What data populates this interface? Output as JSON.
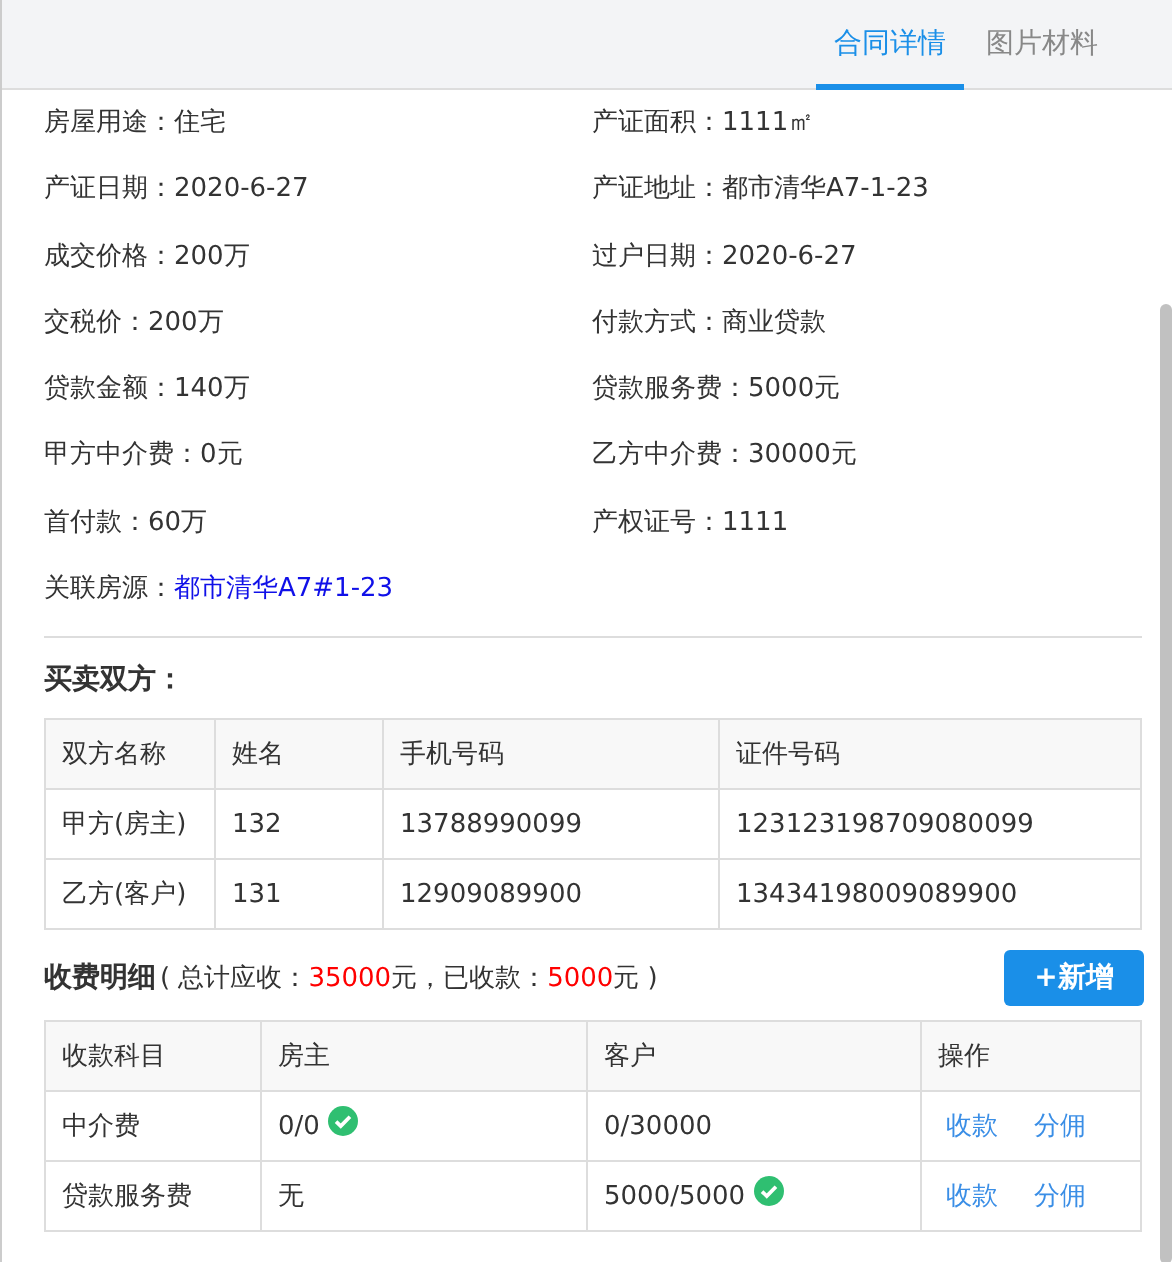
{
  "tabs": [
    {
      "label": "合同详情",
      "selected": true
    },
    {
      "label": "图片材料",
      "selected": false
    }
  ],
  "fields": [
    {
      "text": "房屋用途：住宅"
    },
    {
      "text": "产证面积：1111㎡"
    },
    {
      "text": "产证日期：2020-6-27"
    },
    {
      "text": "产证地址：都市清华A7-1-23"
    },
    {
      "text": "成交价格：200万"
    },
    {
      "text": "过户日期：2020-6-27"
    },
    {
      "text": "交税价：200万"
    },
    {
      "text": "付款方式：商业贷款"
    },
    {
      "text": "贷款金额：140万"
    },
    {
      "text": "贷款服务费：5000元"
    },
    {
      "text": "甲方中介费：0元"
    },
    {
      "text": "乙方中介费：30000元"
    },
    {
      "text": "首付款：60万"
    },
    {
      "text": "产权证号：1111"
    }
  ],
  "linked_listing": {
    "label": "关联房源：",
    "link": "都市清华A7#1-23"
  },
  "parties": {
    "title": "买卖双方：",
    "columns": [
      "双方名称",
      "姓名",
      "手机号码",
      "证件号码"
    ],
    "rows": [
      [
        "甲方(房主)",
        "132",
        "13788990099",
        "123123198709080099"
      ],
      [
        "乙方(客户)",
        "131",
        "12909089900",
        "13434198009089900"
      ]
    ]
  },
  "fees": {
    "title": "收费明细",
    "summary": {
      "prefix": "( 总计应收：",
      "total": "35000",
      "mid": "元，已收款：",
      "received": "5000",
      "suffix": "元 )"
    },
    "add_button": "+新增",
    "columns": [
      "收款科目",
      "房主",
      "客户",
      "操作"
    ],
    "rows": [
      {
        "item": "中介费",
        "owner": {
          "text": "0/0",
          "paid": true
        },
        "client": {
          "text": "0/30000",
          "paid": false
        },
        "actions": [
          "收款",
          "分佣"
        ]
      },
      {
        "item": "贷款服务费",
        "owner": {
          "text": "无",
          "paid": false
        },
        "client": {
          "text": "5000/5000",
          "paid": true
        },
        "actions": [
          "收款",
          "分佣"
        ]
      }
    ]
  }
}
